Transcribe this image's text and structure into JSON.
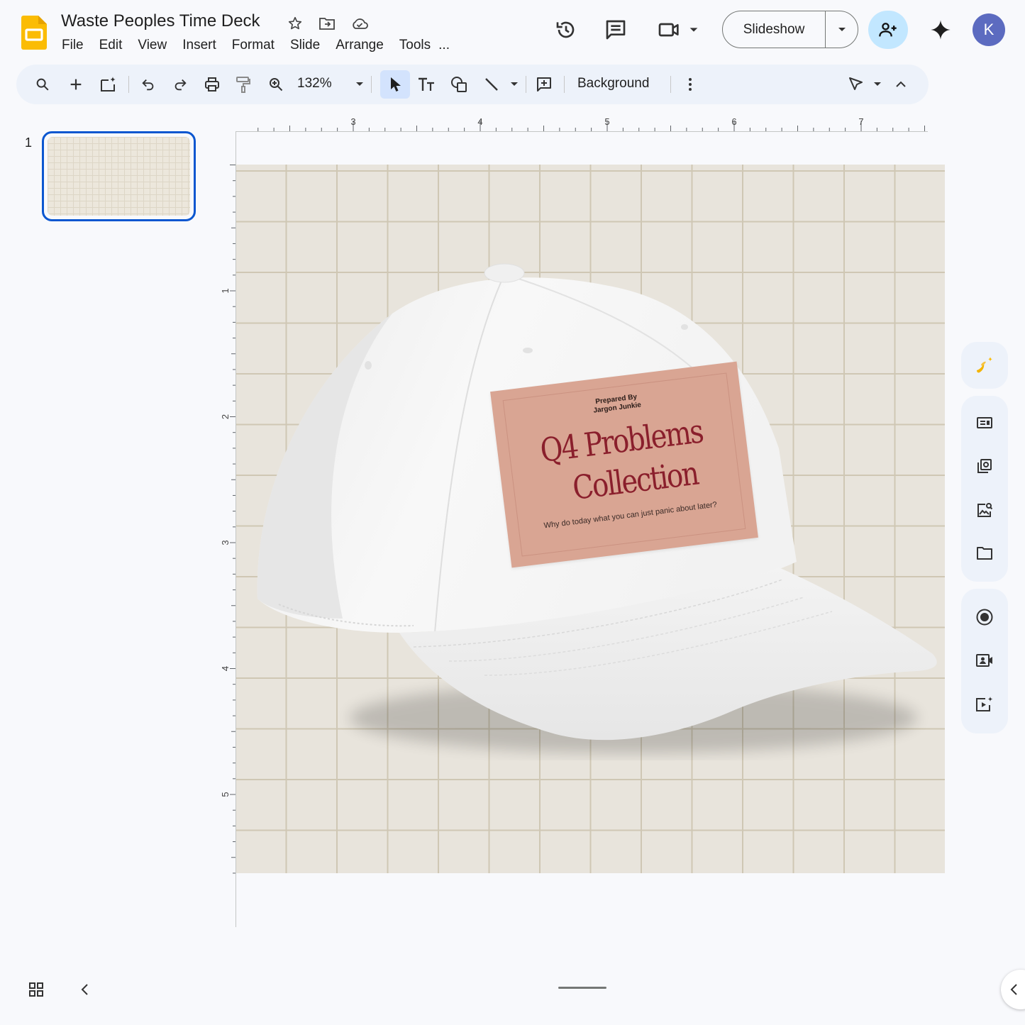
{
  "document": {
    "title": "Waste Peoples Time Deck"
  },
  "menu": [
    "File",
    "Edit",
    "View",
    "Insert",
    "Format",
    "Slide",
    "Arrange",
    "Tools",
    "..."
  ],
  "header": {
    "slideshow_label": "Slideshow",
    "avatar_initial": "K",
    "share_icon": "person-add-icon",
    "accent_color": "#0b57d0",
    "share_bg_color": "#c2e7ff",
    "avatar_color": "#5c6bc0"
  },
  "toolbar": {
    "zoom": "132%",
    "background_label": "Background"
  },
  "slides_panel": {
    "slide_number": "1"
  },
  "rulers": {
    "horizontal_labels": [
      "3",
      "4",
      "5",
      "6",
      "7"
    ],
    "vertical_labels": [
      "1",
      "2",
      "3",
      "4",
      "5"
    ]
  },
  "slide": {
    "patch": {
      "prepared_by_label": "Prepared By",
      "author": "Jargon Junkie",
      "title_line1": "Q4 Problems",
      "title_line2": "Collection",
      "subtitle": "Why do today what you can just panic about later?"
    },
    "background_color": "#e8e4dc",
    "patch_color": "#d9a593",
    "title_color": "#8a1f2c"
  }
}
